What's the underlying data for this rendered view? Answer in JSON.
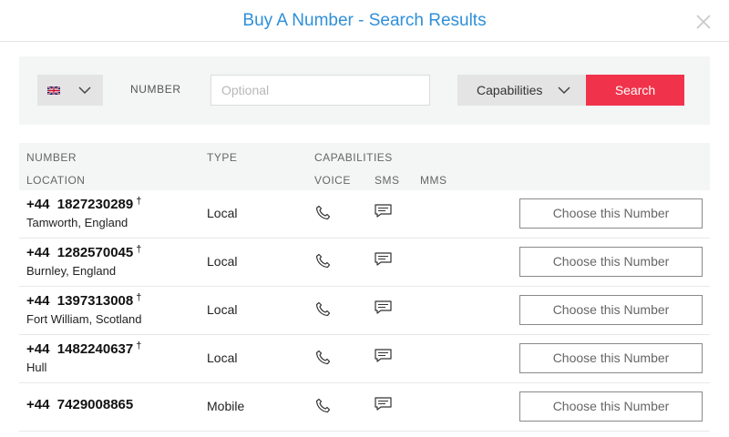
{
  "dialog": {
    "title": "Buy A Number - Search Results"
  },
  "icons": {
    "close": "close-icon",
    "flag": "uk-flag-icon",
    "chevron": "chevron-down-icon",
    "voice": "phone-icon",
    "sms": "message-icon"
  },
  "colors": {
    "title": "#2f8fd8",
    "search_button": "#f0334b",
    "panel": "#f4f5f5"
  },
  "search": {
    "number_label": "NUMBER",
    "number_placeholder": "Optional",
    "capabilities_label": "Capabilities",
    "search_button": "Search"
  },
  "table": {
    "headers": {
      "number": "NUMBER",
      "location": "LOCATION",
      "type": "TYPE",
      "capabilities": "CAPABILITIES",
      "voice": "VOICE",
      "sms": "SMS",
      "mms": "MMS"
    },
    "rows": [
      {
        "prefix": "+44",
        "number": "1827230289",
        "dagger": "†",
        "location": "Tamworth, England",
        "type": "Local",
        "voice": true,
        "sms": true,
        "mms": false,
        "action": "Choose this Number"
      },
      {
        "prefix": "+44",
        "number": "1282570045",
        "dagger": "†",
        "location": "Burnley, England",
        "type": "Local",
        "voice": true,
        "sms": true,
        "mms": false,
        "action": "Choose this Number"
      },
      {
        "prefix": "+44",
        "number": "1397313008",
        "dagger": "†",
        "location": "Fort William, Scotland",
        "type": "Local",
        "voice": true,
        "sms": true,
        "mms": false,
        "action": "Choose this Number"
      },
      {
        "prefix": "+44",
        "number": "1482240637",
        "dagger": "†",
        "location": "Hull",
        "type": "Local",
        "voice": true,
        "sms": true,
        "mms": false,
        "action": "Choose this Number"
      },
      {
        "prefix": "+44",
        "number": "7429008865",
        "dagger": "",
        "location": "",
        "type": "Mobile",
        "voice": true,
        "sms": true,
        "mms": false,
        "action": "Choose this Number"
      }
    ]
  }
}
